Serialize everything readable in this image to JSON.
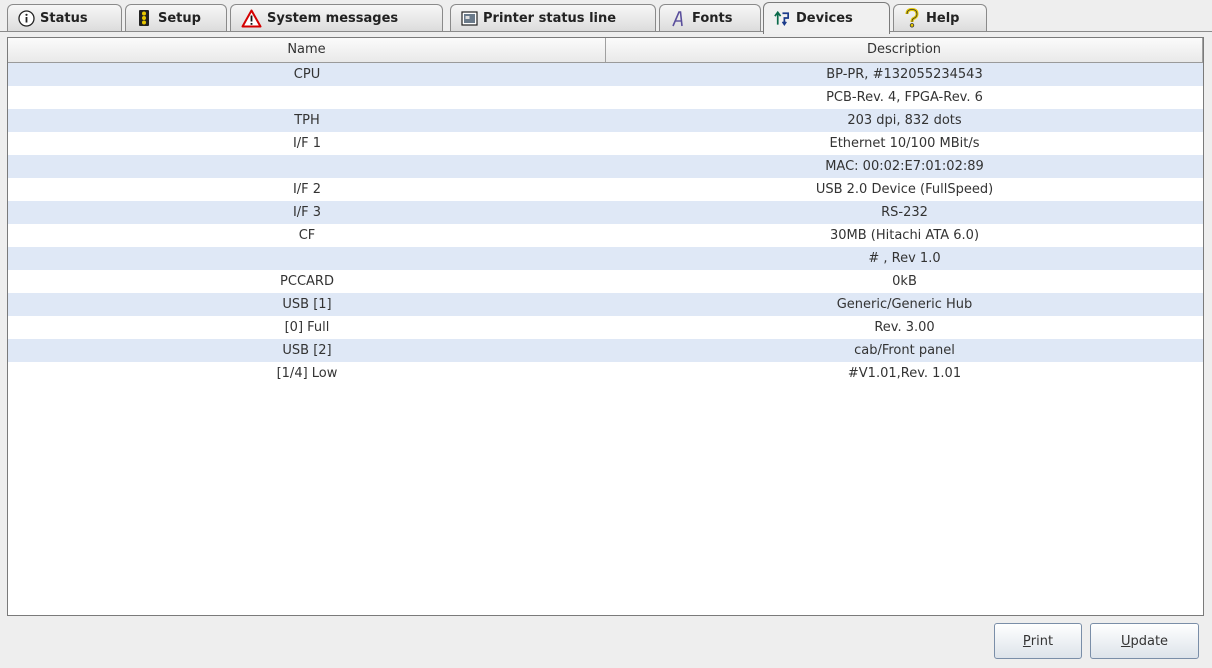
{
  "tabs": [
    {
      "label": "Status",
      "icon": "info-icon"
    },
    {
      "label": "Setup",
      "icon": "traffic-light-icon"
    },
    {
      "label": "System messages",
      "icon": "warning-icon"
    },
    {
      "label": "Printer status line",
      "icon": "display-icon"
    },
    {
      "label": "Fonts",
      "icon": "font-icon"
    },
    {
      "label": "Devices",
      "icon": "devices-icon",
      "active": true
    },
    {
      "label": "Help",
      "icon": "help-icon"
    }
  ],
  "table": {
    "headers": {
      "name": "Name",
      "description": "Description"
    },
    "rows": [
      {
        "name": "CPU",
        "description": "BP-PR, #132055234543"
      },
      {
        "name": "",
        "description": "PCB-Rev. 4, FPGA-Rev. 6"
      },
      {
        "name": "TPH",
        "description": "203 dpi, 832 dots"
      },
      {
        "name": "I/F 1",
        "description": "Ethernet 10/100 MBit/s"
      },
      {
        "name": "",
        "description": "MAC: 00:02:E7:01:02:89"
      },
      {
        "name": "I/F 2",
        "description": "USB 2.0 Device (FullSpeed)"
      },
      {
        "name": "I/F 3",
        "description": "RS-232"
      },
      {
        "name": "CF",
        "description": "30MB (Hitachi ATA  6.0)"
      },
      {
        "name": "",
        "description": "# , Rev 1.0"
      },
      {
        "name": "PCCARD",
        "description": "0kB"
      },
      {
        "name": "USB [1]",
        "description": "Generic/Generic Hub"
      },
      {
        "name": "[0] Full",
        "description": "Rev. 3.00"
      },
      {
        "name": "USB [2]",
        "description": "cab/Front panel"
      },
      {
        "name": "[1/4] Low",
        "description": "#V1.01,Rev. 1.01"
      }
    ]
  },
  "buttons": {
    "print": {
      "mnemonic": "P",
      "rest": "rint"
    },
    "update": {
      "mnemonic": "U",
      "rest": "pdate"
    }
  },
  "colors": {
    "row_stripe": "#dfe8f6",
    "background": "#eeeeee"
  }
}
